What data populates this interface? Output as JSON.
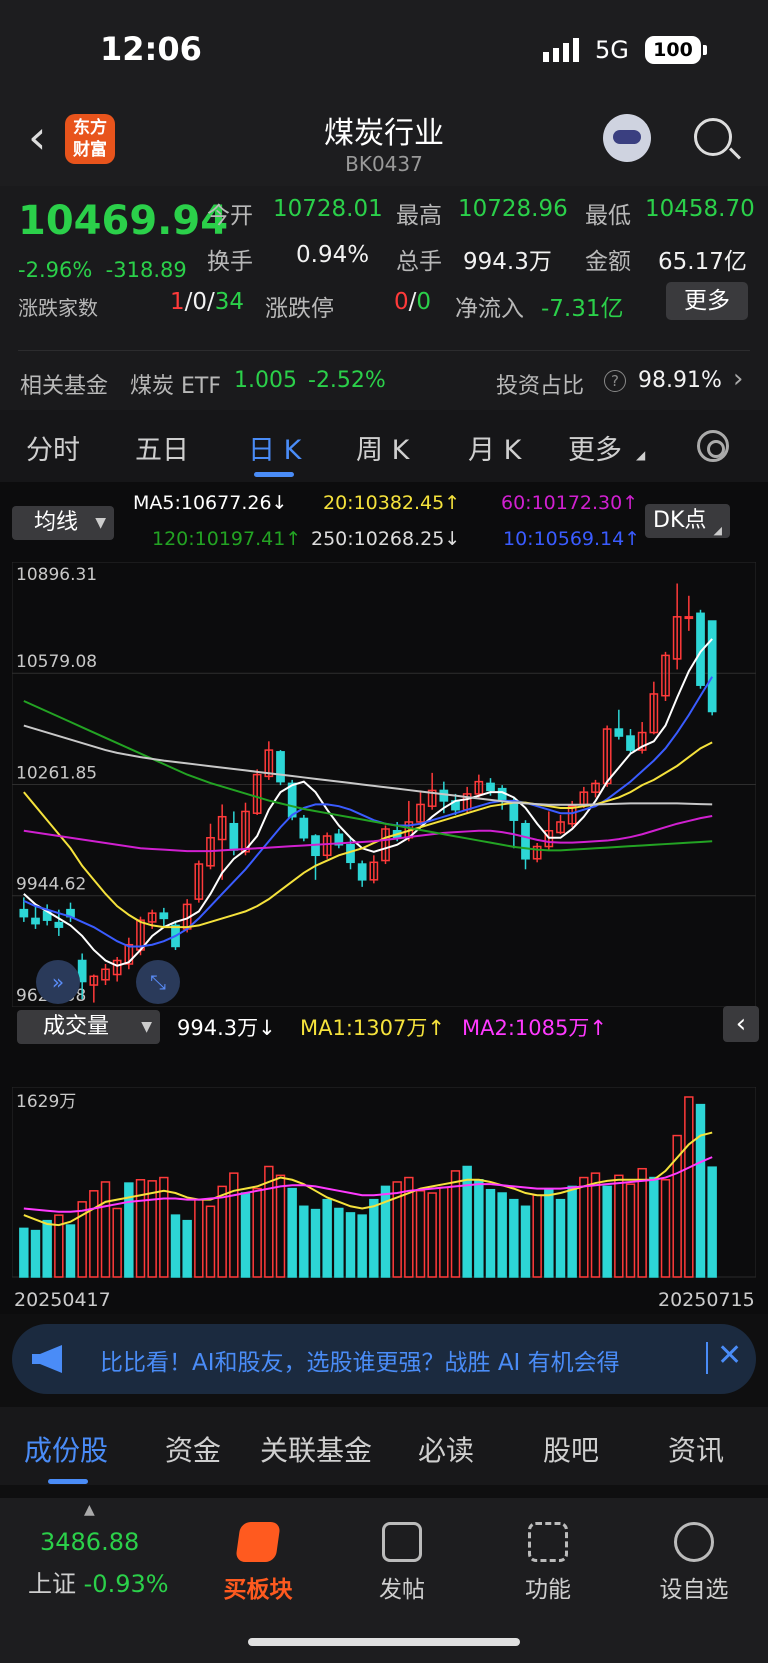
{
  "status": {
    "time": "12:06",
    "network": "5G",
    "battery": "100"
  },
  "header": {
    "title": "煤炭行业",
    "code": "BK0437",
    "logo_line1": "东方",
    "logo_line2": "财富"
  },
  "quote": {
    "price": "10469.94",
    "change_pct": "-2.96%",
    "change_abs": "-318.89",
    "open_label": "今开",
    "open": "10728.01",
    "high_label": "最高",
    "high": "10728.96",
    "low_label": "最低",
    "low": "10458.70",
    "turnover_label": "换手",
    "turnover": "0.94%",
    "volume_label": "总手",
    "volume": "994.3万",
    "amount_label": "金额",
    "amount": "65.17亿",
    "breadth_label": "涨跌家数",
    "breadth_up": "1",
    "breadth_sep1": "/",
    "breadth_flat": "0",
    "breadth_sep2": "/",
    "breadth_down": "34",
    "limit_label": "涨跌停",
    "limit_up": "0",
    "limit_sep": "/",
    "limit_down": "0",
    "inflow_label": "净流入",
    "inflow": "-7.31亿",
    "more_label": "更多",
    "fund_label": "相关基金",
    "fund_name": "煤炭 ETF",
    "fund_price": "1.005",
    "fund_chg": "-2.52%",
    "weight_label": "投资占比",
    "weight_help": "?",
    "weight": "98.91%"
  },
  "period_tabs": [
    "分时",
    "五日",
    "日 K",
    "周 K",
    "月 K",
    "更多"
  ],
  "active_period": "日 K",
  "ma_panel": {
    "selector_label": "均线",
    "ma5": "MA5:10677.26↓",
    "ma20": "20:10382.45↑",
    "ma60": "60:10172.30↑",
    "ma120": "120:10197.41↑",
    "ma250": "250:10268.25↓",
    "ma10": "10:10569.14↑",
    "dk_label": "DK点"
  },
  "volume_panel": {
    "selector_label": "成交量",
    "current": "994.3万↓",
    "ma1": "MA1:1307万↑",
    "ma2": "MA2:1085万↑",
    "max_label": "1629万"
  },
  "colors": {
    "up": "#ff3a3a",
    "down": "#2dd6d6",
    "ma5": "#ffffff",
    "ma10": "#3a5cff",
    "ma20": "#f5e23c",
    "ma60": "#d020d0",
    "ma120": "#23a323",
    "ma250": "#c8c8c8"
  },
  "chart_data": {
    "type": "candlestick",
    "y_tick_labels": [
      "10896.31",
      "10579.08",
      "10261.85",
      "9944.62",
      "9627.38"
    ],
    "ylim": [
      9627.38,
      10896.31
    ],
    "x_labels": [
      "20250417",
      "20250715"
    ],
    "candles": [
      [
        9905,
        9885,
        9940,
        9870
      ],
      [
        9880,
        9865,
        9915,
        9850
      ],
      [
        9900,
        9875,
        9920,
        9860
      ],
      [
        9868,
        9855,
        9905,
        9830
      ],
      [
        9905,
        9885,
        9925,
        9870
      ],
      [
        9760,
        9700,
        9780,
        9650
      ],
      [
        9690,
        9715,
        9720,
        9640
      ],
      [
        9705,
        9735,
        9750,
        9690
      ],
      [
        9720,
        9760,
        9770,
        9700
      ],
      [
        9750,
        9805,
        9825,
        9735
      ],
      [
        9790,
        9875,
        9885,
        9775
      ],
      [
        9870,
        9895,
        9905,
        9850
      ],
      [
        9895,
        9880,
        9910,
        9855
      ],
      [
        9860,
        9800,
        9870,
        9790
      ],
      [
        9850,
        9920,
        9935,
        9840
      ],
      [
        9935,
        10035,
        10045,
        9925
      ],
      [
        10030,
        10110,
        10150,
        10020
      ],
      [
        10105,
        10170,
        10205,
        9990
      ],
      [
        10150,
        10075,
        10185,
        10060
      ],
      [
        10070,
        10185,
        10210,
        10060
      ],
      [
        10180,
        10290,
        10305,
        10175
      ],
      [
        10285,
        10360,
        10385,
        10275
      ],
      [
        10355,
        10270,
        10360,
        10260
      ],
      [
        10265,
        10170,
        10275,
        10160
      ],
      [
        10165,
        10110,
        10175,
        10100
      ],
      [
        10115,
        10060,
        10120,
        9990
      ],
      [
        10060,
        10115,
        10125,
        10050
      ],
      [
        10120,
        10090,
        10135,
        10080
      ],
      [
        10090,
        10040,
        10110,
        10020
      ],
      [
        10035,
        9990,
        10045,
        9970
      ],
      [
        9990,
        10040,
        10060,
        9980
      ],
      [
        10045,
        10135,
        10145,
        10035
      ],
      [
        10130,
        10110,
        10155,
        10100
      ],
      [
        10110,
        10155,
        10215,
        10100
      ],
      [
        10155,
        10205,
        10245,
        10145
      ],
      [
        10200,
        10245,
        10295,
        10190
      ],
      [
        10245,
        10215,
        10270,
        10180
      ],
      [
        10215,
        10190,
        10235,
        10175
      ],
      [
        10190,
        10235,
        10255,
        10180
      ],
      [
        10235,
        10270,
        10290,
        10225
      ],
      [
        10265,
        10245,
        10280,
        10230
      ],
      [
        10250,
        10215,
        10260,
        10190
      ],
      [
        10215,
        10160,
        10225,
        10080
      ],
      [
        10150,
        10050,
        10160,
        10020
      ],
      [
        10050,
        10085,
        10095,
        10040
      ],
      [
        10085,
        10130,
        10185,
        10075
      ],
      [
        10125,
        10155,
        10175,
        10120
      ],
      [
        10150,
        10200,
        10215,
        10140
      ],
      [
        10205,
        10240,
        10255,
        10195
      ],
      [
        10240,
        10265,
        10275,
        10225
      ],
      [
        10265,
        10420,
        10430,
        10255
      ],
      [
        10420,
        10400,
        10475,
        10390
      ],
      [
        10400,
        10360,
        10420,
        10350
      ],
      [
        10360,
        10410,
        10440,
        10350
      ],
      [
        10410,
        10520,
        10555,
        10405
      ],
      [
        10515,
        10630,
        10640,
        10500
      ],
      [
        10620,
        10740,
        10835,
        10590
      ],
      [
        10740,
        10740,
        10800,
        10700
      ],
      [
        10750,
        10545,
        10760,
        10535
      ],
      [
        10728,
        10470,
        10729,
        10459
      ]
    ],
    "candle_fields": [
      "open",
      "close",
      "high",
      "low"
    ],
    "ma_series": [
      {
        "name": "MA5",
        "values": [
          9950,
          9920,
          9900,
          9880,
          9860,
          9830,
          9790,
          9760,
          9745,
          9755,
          9790,
          9830,
          9855,
          9870,
          9880,
          9900,
          9950,
          10010,
          10050,
          10075,
          10115,
          10190,
          10240,
          10260,
          10270,
          10240,
          10190,
          10145,
          10110,
          10080,
          10070,
          10080,
          10090,
          10110,
          10140,
          10170,
          10195,
          10215,
          10220,
          10230,
          10240,
          10240,
          10225,
          10195,
          10150,
          10110,
          10110,
          10135,
          10170,
          10215,
          10270,
          10310,
          10350,
          10370,
          10385,
          10430,
          10510,
          10585,
          10640,
          10677
        ]
      },
      {
        "name": "MA10",
        "values": [
          9930,
          9915,
          9905,
          9895,
          9885,
          9870,
          9855,
          9835,
          9815,
          9800,
          9800,
          9805,
          9815,
          9830,
          9850,
          9880,
          9915,
          9950,
          9985,
          10020,
          10060,
          10100,
          10140,
          10175,
          10195,
          10205,
          10205,
          10200,
          10190,
          10175,
          10160,
          10150,
          10145,
          10145,
          10150,
          10160,
          10170,
          10180,
          10190,
          10200,
          10210,
          10215,
          10215,
          10210,
          10200,
          10190,
          10180,
          10180,
          10190,
          10200,
          10220,
          10245,
          10270,
          10300,
          10330,
          10365,
          10410,
          10460,
          10515,
          10569
        ]
      },
      {
        "name": "MA20",
        "values": [
          10240,
          10200,
          10160,
          10120,
          10080,
          10030,
          9990,
          9950,
          9915,
          9890,
          9870,
          9860,
          9855,
          9855,
          9855,
          9860,
          9870,
          9880,
          9890,
          9900,
          9915,
          9935,
          9960,
          9985,
          10010,
          10030,
          10045,
          10060,
          10070,
          10080,
          10095,
          10110,
          10120,
          10130,
          10140,
          10150,
          10160,
          10170,
          10180,
          10190,
          10200,
          10205,
          10210,
          10210,
          10205,
          10200,
          10195,
          10195,
          10200,
          10205,
          10215,
          10225,
          10240,
          10260,
          10275,
          10295,
          10315,
          10340,
          10365,
          10382
        ]
      },
      {
        "name": "MA60",
        "values": [
          10130,
          10125,
          10120,
          10115,
          10110,
          10105,
          10100,
          10095,
          10090,
          10085,
          10080,
          10078,
          10076,
          10074,
          10072,
          10072,
          10072,
          10074,
          10076,
          10078,
          10080,
          10082,
          10084,
          10086,
          10088,
          10090,
          10092,
          10094,
          10096,
          10098,
          10100,
          10104,
          10108,
          10112,
          10116,
          10120,
          10124,
          10126,
          10128,
          10130,
          10130,
          10126,
          10120,
          10112,
          10104,
          10098,
          10096,
          10096,
          10098,
          10100,
          10102,
          10106,
          10112,
          10120,
          10130,
          10140,
          10150,
          10158,
          10166,
          10172
        ]
      },
      {
        "name": "MA120",
        "values": [
          10500,
          10485,
          10470,
          10455,
          10440,
          10425,
          10410,
          10395,
          10380,
          10365,
          10350,
          10335,
          10320,
          10305,
          10290,
          10278,
          10266,
          10256,
          10246,
          10236,
          10226,
          10216,
          10208,
          10200,
          10192,
          10186,
          10180,
          10174,
          10168,
          10162,
          10156,
          10150,
          10144,
          10138,
          10132,
          10126,
          10120,
          10114,
          10108,
          10102,
          10096,
          10090,
          10084,
          10080,
          10076,
          10074,
          10074,
          10076,
          10078,
          10080,
          10082,
          10084,
          10086,
          10088,
          10090,
          10092,
          10094,
          10096,
          10098,
          10100
        ]
      },
      {
        "name": "MA250",
        "values": [
          10430,
          10420,
          10410,
          10400,
          10390,
          10380,
          10370,
          10360,
          10352,
          10346,
          10340,
          10335,
          10330,
          10326,
          10322,
          10318,
          10314,
          10310,
          10306,
          10302,
          10298,
          10294,
          10290,
          10286,
          10282,
          10278,
          10274,
          10270,
          10266,
          10262,
          10258,
          10254,
          10250,
          10246,
          10242,
          10238,
          10234,
          10230,
          10226,
          10222,
          10218,
          10214,
          10210,
          10208,
          10206,
          10204,
          10204,
          10204,
          10204,
          10205,
          10206,
          10207,
          10208,
          10208,
          10208,
          10208,
          10208,
          10207,
          10206,
          10205
        ]
      }
    ],
    "volume": {
      "max_label_value": 1629,
      "unit": "万",
      "bars": [
        [
          440,
          0
        ],
        [
          420,
          0
        ],
        [
          510,
          0
        ],
        [
          560,
          1
        ],
        [
          470,
          0
        ],
        [
          680,
          1
        ],
        [
          780,
          1
        ],
        [
          860,
          1
        ],
        [
          620,
          1
        ],
        [
          850,
          0
        ],
        [
          880,
          1
        ],
        [
          870,
          1
        ],
        [
          900,
          1
        ],
        [
          560,
          0
        ],
        [
          510,
          0
        ],
        [
          700,
          1
        ],
        [
          640,
          1
        ],
        [
          820,
          1
        ],
        [
          940,
          1
        ],
        [
          760,
          0
        ],
        [
          800,
          1
        ],
        [
          1000,
          1
        ],
        [
          920,
          1
        ],
        [
          800,
          0
        ],
        [
          640,
          0
        ],
        [
          610,
          0
        ],
        [
          700,
          0
        ],
        [
          620,
          0
        ],
        [
          580,
          0
        ],
        [
          560,
          0
        ],
        [
          700,
          0
        ],
        [
          820,
          0
        ],
        [
          860,
          1
        ],
        [
          900,
          1
        ],
        [
          780,
          1
        ],
        [
          760,
          1
        ],
        [
          810,
          1
        ],
        [
          960,
          1
        ],
        [
          1000,
          0
        ],
        [
          880,
          0
        ],
        [
          790,
          0
        ],
        [
          760,
          0
        ],
        [
          700,
          0
        ],
        [
          640,
          0
        ],
        [
          740,
          1
        ],
        [
          790,
          0
        ],
        [
          700,
          0
        ],
        [
          820,
          0
        ],
        [
          900,
          1
        ],
        [
          940,
          1
        ],
        [
          820,
          0
        ],
        [
          920,
          1
        ],
        [
          840,
          1
        ],
        [
          980,
          1
        ],
        [
          900,
          0
        ],
        [
          880,
          1
        ],
        [
          1280,
          1
        ],
        [
          1629,
          1
        ],
        [
          1560,
          0
        ],
        [
          994,
          0
        ]
      ],
      "bar_fields": [
        "value",
        "up"
      ],
      "ma1": [
        560,
        520,
        480,
        470,
        500,
        560,
        620,
        680,
        700,
        720,
        740,
        760,
        780,
        760,
        720,
        700,
        700,
        740,
        780,
        800,
        820,
        860,
        900,
        880,
        840,
        780,
        720,
        680,
        640,
        620,
        640,
        680,
        720,
        760,
        800,
        820,
        840,
        860,
        880,
        880,
        860,
        830,
        800,
        760,
        740,
        740,
        760,
        790,
        820,
        850,
        870,
        880,
        880,
        880,
        880,
        960,
        1080,
        1200,
        1280,
        1307
      ],
      "ma2": [
        620,
        610,
        600,
        590,
        590,
        600,
        620,
        640,
        660,
        680,
        690,
        700,
        710,
        710,
        700,
        700,
        710,
        720,
        740,
        760,
        780,
        800,
        820,
        830,
        830,
        820,
        800,
        780,
        760,
        740,
        740,
        750,
        760,
        780,
        790,
        800,
        810,
        820,
        830,
        840,
        840,
        830,
        820,
        810,
        800,
        800,
        800,
        810,
        820,
        830,
        840,
        850,
        860,
        870,
        880,
        900,
        940,
        990,
        1040,
        1085
      ]
    }
  },
  "banner": {
    "text": "比比看！AI和股友，选股谁更强？战胜 AI 有机会得"
  },
  "bottom_tabs": [
    "成份股",
    "资金",
    "关联基金",
    "必读",
    "股吧",
    "资讯"
  ],
  "active_bottom_tab": "成份股",
  "toolbar": {
    "index_value": "3486.88",
    "index_name": "上证",
    "index_chg": "-0.93%",
    "buy_label": "买板块",
    "post_label": "发帖",
    "func_label": "功能",
    "watch_label": "设自选"
  }
}
